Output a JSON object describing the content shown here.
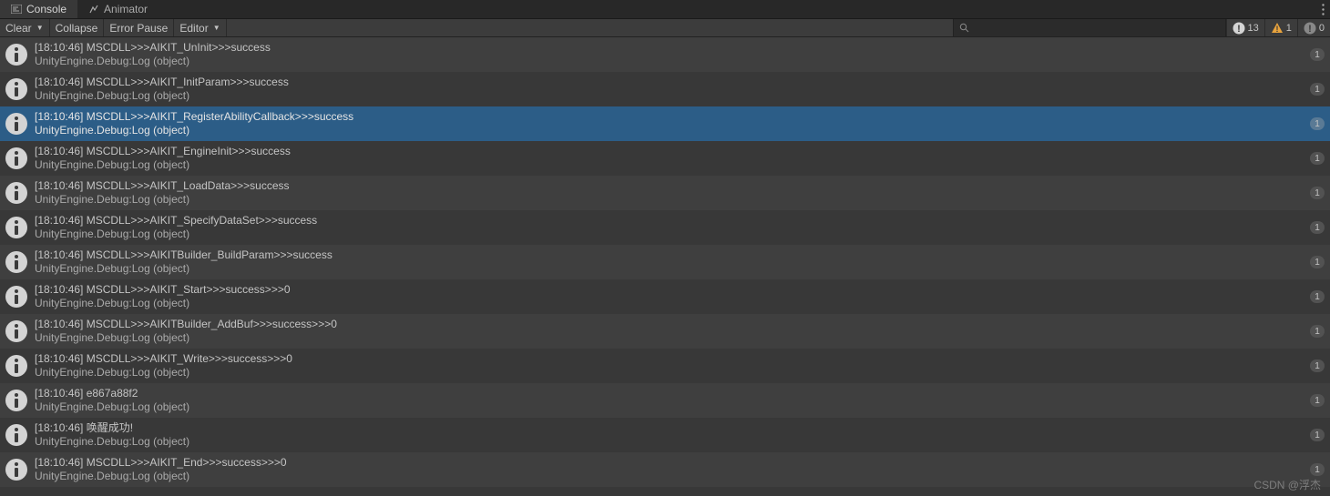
{
  "tabs": {
    "console": "Console",
    "animator": "Animator"
  },
  "toolbar": {
    "clear": "Clear",
    "collapse": "Collapse",
    "error_pause": "Error Pause",
    "editor": "Editor",
    "search_placeholder": ""
  },
  "counters": {
    "info": "13",
    "warning": "1",
    "error": "0"
  },
  "logs": [
    {
      "line1": "[18:10:46] MSCDLL>>>AIKIT_UnInit>>>success",
      "line2": "UnityEngine.Debug:Log (object)",
      "count": "1",
      "selected": false
    },
    {
      "line1": "[18:10:46] MSCDLL>>>AIKIT_InitParam>>>success",
      "line2": "UnityEngine.Debug:Log (object)",
      "count": "1",
      "selected": false
    },
    {
      "line1": "[18:10:46] MSCDLL>>>AIKIT_RegisterAbilityCallback>>>success",
      "line2": "UnityEngine.Debug:Log (object)",
      "count": "1",
      "selected": true
    },
    {
      "line1": "[18:10:46] MSCDLL>>>AIKIT_EngineInit>>>success",
      "line2": "UnityEngine.Debug:Log (object)",
      "count": "1",
      "selected": false
    },
    {
      "line1": "[18:10:46] MSCDLL>>>AIKIT_LoadData>>>success",
      "line2": "UnityEngine.Debug:Log (object)",
      "count": "1",
      "selected": false
    },
    {
      "line1": "[18:10:46] MSCDLL>>>AIKIT_SpecifyDataSet>>>success",
      "line2": "UnityEngine.Debug:Log (object)",
      "count": "1",
      "selected": false
    },
    {
      "line1": "[18:10:46] MSCDLL>>>AIKITBuilder_BuildParam>>>success",
      "line2": "UnityEngine.Debug:Log (object)",
      "count": "1",
      "selected": false
    },
    {
      "line1": "[18:10:46] MSCDLL>>>AIKIT_Start>>>success>>>0",
      "line2": "UnityEngine.Debug:Log (object)",
      "count": "1",
      "selected": false
    },
    {
      "line1": "[18:10:46] MSCDLL>>>AIKITBuilder_AddBuf>>>success>>>0",
      "line2": "UnityEngine.Debug:Log (object)",
      "count": "1",
      "selected": false
    },
    {
      "line1": "[18:10:46] MSCDLL>>>AIKIT_Write>>>success>>>0",
      "line2": "UnityEngine.Debug:Log (object)",
      "count": "1",
      "selected": false
    },
    {
      "line1": "[18:10:46] e867a88f2",
      "line2": "UnityEngine.Debug:Log (object)",
      "count": "1",
      "selected": false
    },
    {
      "line1": "[18:10:46] 唤醒成功!",
      "line2": "UnityEngine.Debug:Log (object)",
      "count": "1",
      "selected": false
    },
    {
      "line1": "[18:10:46] MSCDLL>>>AIKIT_End>>>success>>>0",
      "line2": "UnityEngine.Debug:Log (object)",
      "count": "1",
      "selected": false
    }
  ],
  "watermark": "CSDN @浮杰"
}
